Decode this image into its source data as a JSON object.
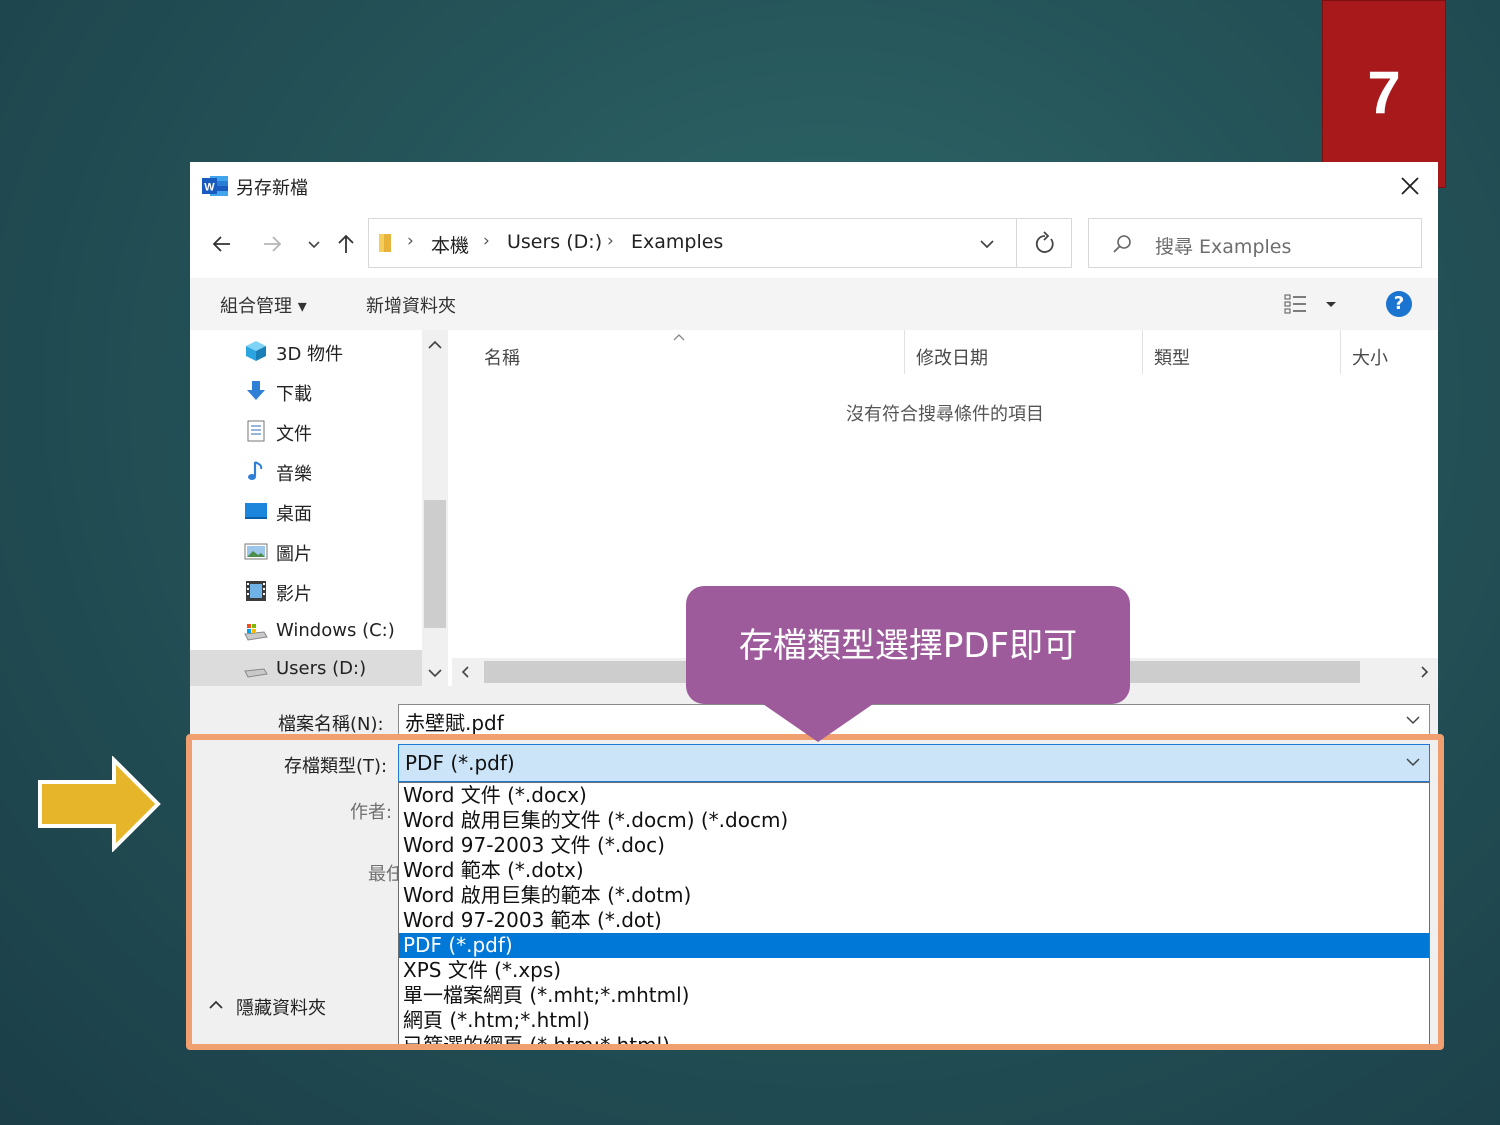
{
  "slide": {
    "number": "7"
  },
  "dialog": {
    "title": "另存新檔",
    "breadcrumb": [
      "本機",
      "Users (D:)",
      "Examples"
    ],
    "search_placeholder": "搜尋 Examples",
    "toolbar": {
      "organize": "組合管理 ▾",
      "new_folder": "新增資料夾",
      "help": "?"
    },
    "nav_items": [
      {
        "label": "3D 物件",
        "icon": "cube-3d-icon"
      },
      {
        "label": "下載",
        "icon": "download-icon"
      },
      {
        "label": "文件",
        "icon": "document-icon"
      },
      {
        "label": "音樂",
        "icon": "music-icon"
      },
      {
        "label": "桌面",
        "icon": "desktop-icon"
      },
      {
        "label": "圖片",
        "icon": "pictures-icon"
      },
      {
        "label": "影片",
        "icon": "video-icon"
      },
      {
        "label": "Windows (C:)",
        "icon": "drive-c-icon"
      },
      {
        "label": "Users (D:)",
        "icon": "drive-d-icon",
        "selected": true
      }
    ],
    "columns": [
      "名稱",
      "修改日期",
      "類型",
      "大小"
    ],
    "empty_message": "沒有符合搜尋條件的項目",
    "filename_label": "檔案名稱(N):",
    "filename_value": "赤壁賦.pdf",
    "filetype_label": "存檔類型(T):",
    "filetype_value": "PDF (*.pdf)",
    "author_label": "作者:",
    "hidden_label_partial": "最任",
    "filetype_options": [
      "Word 文件 (*.docx)",
      "Word 啟用巨集的文件 (*.docm) (*.docm)",
      "Word 97-2003 文件 (*.doc)",
      "Word 範本 (*.dotx)",
      "Word 啟用巨集的範本 (*.dotm)",
      "Word 97-2003 範本 (*.dot)",
      "PDF (*.pdf)",
      "XPS 文件 (*.xps)",
      "單一檔案網頁 (*.mht;*.mhtml)",
      "網頁 (*.htm;*.html)",
      "已篩選的網頁 (*.htm;*.html)"
    ],
    "selected_option_index": 6,
    "hide_folders": "隱藏資料夾"
  },
  "annotation": {
    "callout": "存檔類型選擇PDF即可",
    "highlight_color": "#f0a070",
    "callout_color": "#9d5b9c",
    "arrow_color": "#e7b52a"
  }
}
